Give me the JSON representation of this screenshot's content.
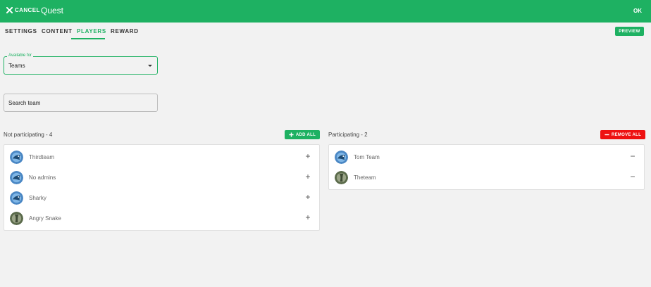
{
  "header": {
    "cancel_label": "CANCEL",
    "title": "Quest",
    "ok_label": "OK",
    "background": "#1eb162"
  },
  "tabs": [
    {
      "label": "SETTINGS"
    },
    {
      "label": "CONTENT"
    },
    {
      "label": "PLAYERS",
      "active": true
    },
    {
      "label": "REWARD"
    }
  ],
  "preview_label": "PREVIEW",
  "available_for": {
    "label": "Available for",
    "value": "Teams"
  },
  "search": {
    "placeholder": "Search team"
  },
  "not_participating": {
    "title": "Not participating - 4",
    "button_label": "ADD ALL",
    "teams": [
      {
        "name": "Thirdteam",
        "avatar": "bird"
      },
      {
        "name": "No admins",
        "avatar": "bird"
      },
      {
        "name": "Sharky",
        "avatar": "bird"
      },
      {
        "name": "Angry Snake",
        "avatar": "stone"
      }
    ]
  },
  "participating": {
    "title": "Participating - 2",
    "button_label": "REMOVE ALL",
    "teams": [
      {
        "name": "Tom Team",
        "avatar": "bird"
      },
      {
        "name": "Theteam",
        "avatar": "stone"
      }
    ]
  },
  "colors": {
    "primary": "#1eb162",
    "danger": "#ee1111"
  }
}
